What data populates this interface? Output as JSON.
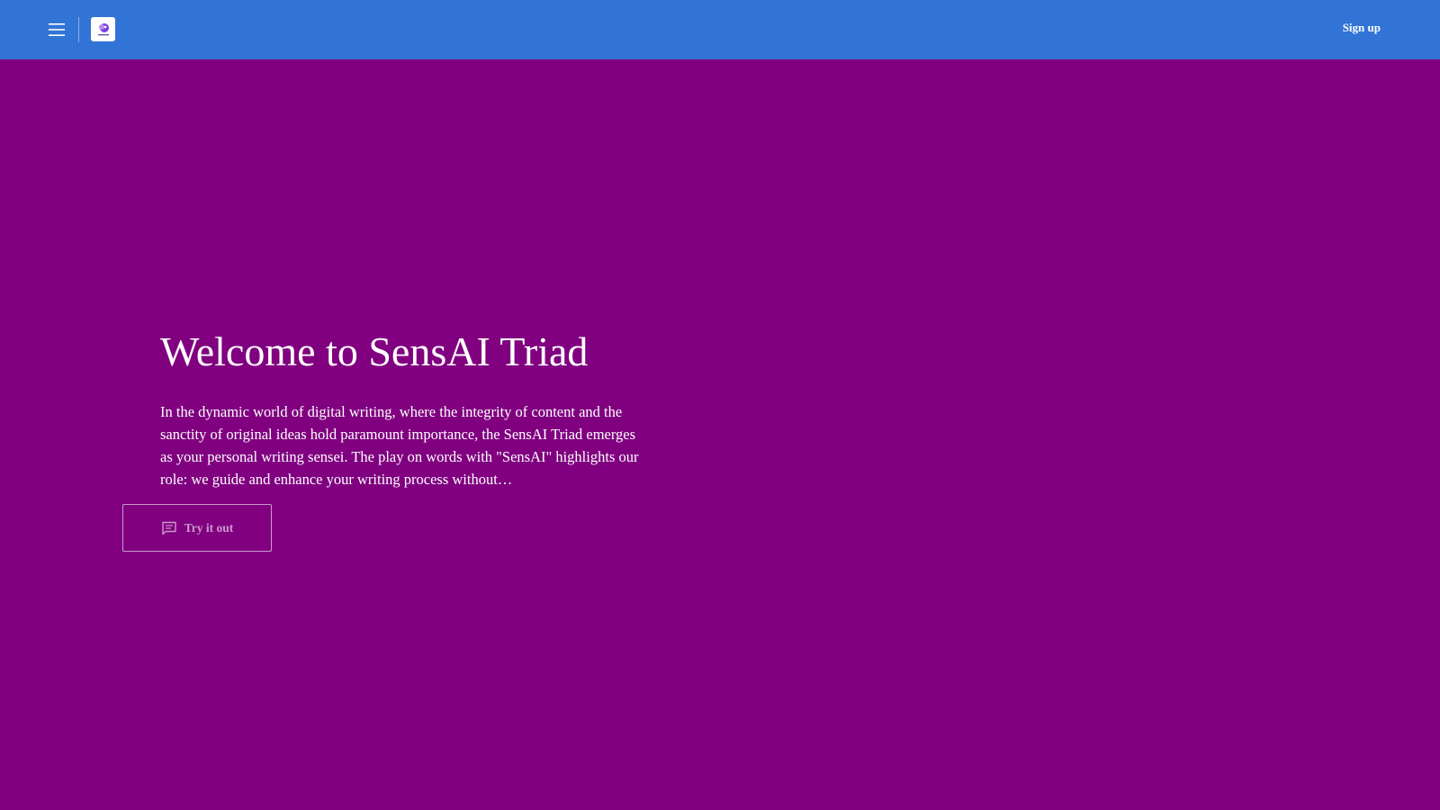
{
  "header": {
    "menu_icon": "hamburger-menu-icon",
    "logo_icon": "sensai-logo-icon",
    "signup_label": "Sign up",
    "background_color": "#3174d6"
  },
  "hero": {
    "title": "Welcome to SensAI Triad",
    "body": "In the dynamic world of digital writing, where the integrity of content and the sanctity of original ideas hold paramount importance, the SensAI Triad emerges as your personal writing sensei. The play on words with \"SensAI\" highlights our role: we guide and enhance your writing process without…",
    "cta_label": "Try it out",
    "cta_icon": "chat-bubble-icon",
    "background_color": "#800080"
  }
}
